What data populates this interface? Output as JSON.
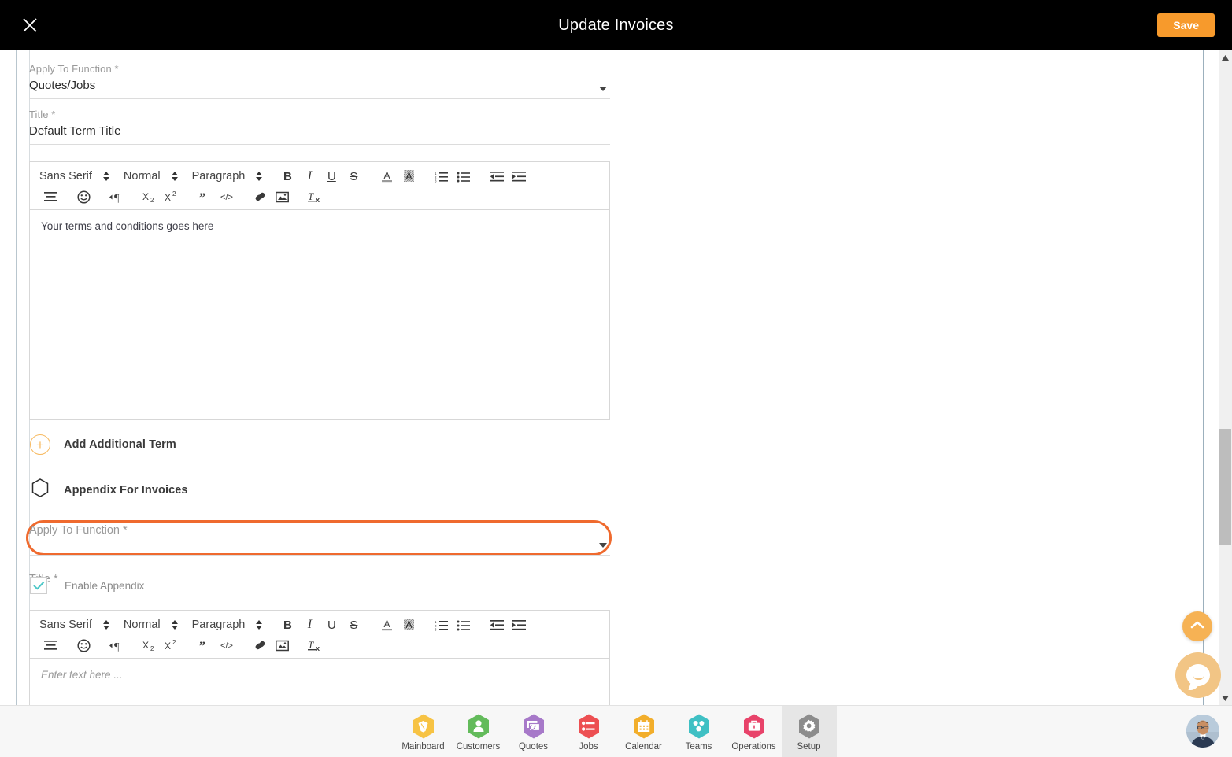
{
  "header": {
    "title": "Update Invoices",
    "save_label": "Save",
    "close_icon": "close-icon",
    "save_color": "#f79a2c"
  },
  "form": {
    "term_section": {
      "function_field": {
        "label": "Apply To Function *",
        "value": "Quotes/Jobs"
      },
      "title_field": {
        "label": "Title *",
        "value": "Default Term Title"
      },
      "editor_content": "Your terms and conditions goes here"
    },
    "add_term": {
      "label": "Add Additional Term",
      "icon": "circle-plus-icon"
    },
    "appendix_header": {
      "label": "Appendix For Invoices",
      "icon": "hexagon-icon"
    },
    "appendix_section": {
      "function_field": {
        "label": "Apply To Function *",
        "value": "",
        "highlighted": true,
        "highlight_color": "#ef6a2e"
      },
      "title_field": {
        "label": "Title *",
        "value": ""
      },
      "enable_checkbox": {
        "label": "Enable Appendix",
        "checked": true,
        "check_color": "#4ec8c8"
      },
      "editor_placeholder": "Enter text here ..."
    }
  },
  "toolbar": {
    "font_family": "Sans Serif",
    "font_size": "Normal",
    "block_type": "Paragraph",
    "row1": [
      {
        "name": "bold-icon",
        "label": "B"
      },
      {
        "name": "italic-icon",
        "label": "I"
      },
      {
        "name": "underline-icon",
        "label": "U"
      },
      {
        "name": "strikethrough-icon",
        "label": "S"
      },
      {
        "name": "text-color-icon",
        "label": "A"
      },
      {
        "name": "highlight-color-icon",
        "label": "A"
      },
      {
        "name": "ordered-list-icon",
        "label": ""
      },
      {
        "name": "bullet-list-icon",
        "label": ""
      },
      {
        "name": "outdent-icon",
        "label": ""
      },
      {
        "name": "indent-icon",
        "label": ""
      }
    ],
    "row2": [
      {
        "name": "align-icon",
        "label": ""
      },
      {
        "name": "emoji-icon",
        "label": ""
      },
      {
        "name": "text-direction-icon",
        "label": ""
      },
      {
        "name": "subscript-icon",
        "label": "X2"
      },
      {
        "name": "superscript-icon",
        "label": "X2"
      },
      {
        "name": "blockquote-icon",
        "label": ""
      },
      {
        "name": "code-block-icon",
        "label": "</>"
      },
      {
        "name": "link-icon",
        "label": ""
      },
      {
        "name": "image-icon",
        "label": ""
      },
      {
        "name": "clear-format-icon",
        "label": "Tx"
      }
    ]
  },
  "floating": {
    "scroll_top_label": "scroll-to-top",
    "chat_label": "chat",
    "scroll_top_color": "#f6b254",
    "chat_color": "#f2c585"
  },
  "bottom_nav": {
    "items": [
      {
        "label": "Mainboard",
        "icon": "mainboard-icon",
        "color": "#f7c344",
        "active": false
      },
      {
        "label": "Customers",
        "icon": "customers-icon",
        "color": "#63bb5b",
        "active": false
      },
      {
        "label": "Quotes",
        "icon": "quotes-icon",
        "color": "#a779c9",
        "active": false
      },
      {
        "label": "Jobs",
        "icon": "jobs-icon",
        "color": "#ed4f52",
        "active": false
      },
      {
        "label": "Calendar",
        "icon": "calendar-icon",
        "color": "#f2ae2b",
        "active": false
      },
      {
        "label": "Teams",
        "icon": "teams-icon",
        "color": "#3fc0c4",
        "active": false
      },
      {
        "label": "Operations",
        "icon": "operations-icon",
        "color": "#e8436a",
        "active": false
      },
      {
        "label": "Setup",
        "icon": "setup-gear-icon",
        "color": "#8c8c8c",
        "active": true
      }
    ],
    "avatar": "user-avatar"
  },
  "scrollbar": {
    "up_arrow": "scroll-up-arrow-icon",
    "down_arrow": "scroll-down-arrow-icon"
  }
}
